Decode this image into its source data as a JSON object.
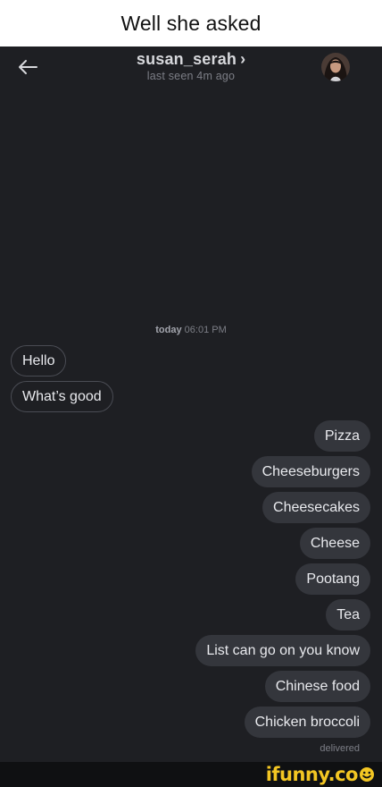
{
  "caption": "Well she asked",
  "header": {
    "back_icon": "arrow-left-icon",
    "contact_name": "susan_serah",
    "chevron": "›",
    "last_seen": "last seen 4m ago"
  },
  "date_separator": {
    "day": "today",
    "time": "06:01 PM"
  },
  "incoming_messages": [
    "Hello",
    "What’s good"
  ],
  "outgoing_messages": [
    "Pizza",
    "Cheeseburgers",
    "Cheesecakes",
    "Cheese",
    "Pootang",
    "Tea",
    "List can go on you know",
    "Chinese food",
    "Chicken broccoli"
  ],
  "status": "delivered",
  "watermark": {
    "text": "ifunny.co",
    "icon": "smiley-icon"
  },
  "colors": {
    "background": "#1e1f23",
    "outgoing_bubble": "#34363c",
    "incoming_border": "#4a4c54",
    "watermark": "#f3c623"
  }
}
